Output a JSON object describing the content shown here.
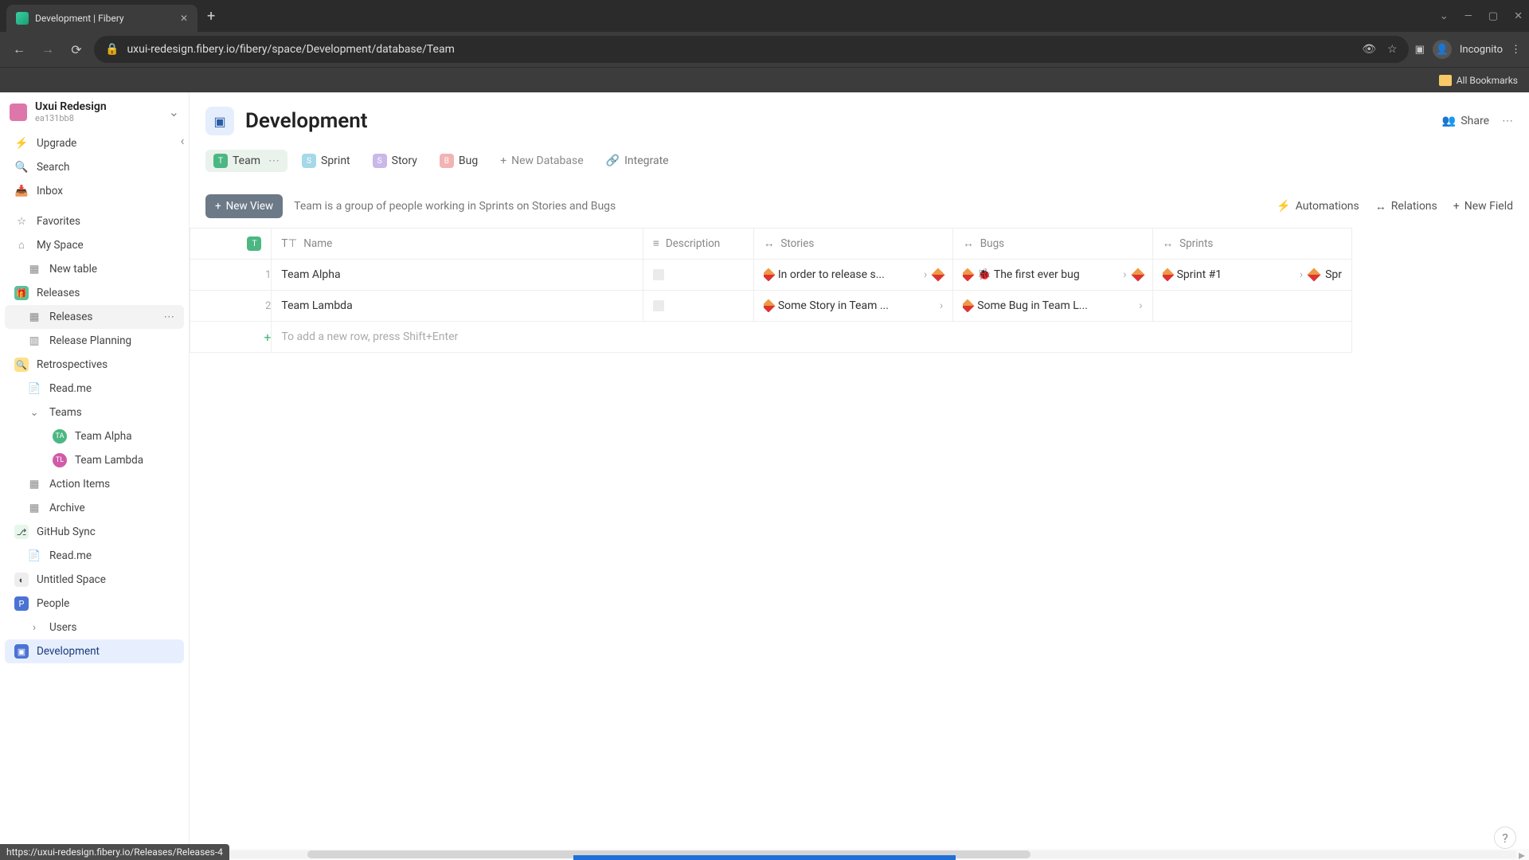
{
  "browser": {
    "tab_title": "Development | Fibery",
    "url": "uxui-redesign.fibery.io/fibery/space/Development/database/Team",
    "incognito_label": "Incognito",
    "bookmarks_label": "All Bookmarks"
  },
  "workspace": {
    "name": "Uxui Redesign",
    "sub": "ea131bb8"
  },
  "sidebar": {
    "upgrade": "Upgrade",
    "search": "Search",
    "inbox": "Inbox",
    "favorites": "Favorites",
    "myspace": "My Space",
    "newtable": "New table",
    "releases": "Releases",
    "releases_sub": "Releases",
    "release_planning": "Release Planning",
    "retro": "Retrospectives",
    "readme1": "Read.me",
    "teams": "Teams",
    "team_alpha": "Team Alpha",
    "team_lambda": "Team Lambda",
    "action_items": "Action Items",
    "archive": "Archive",
    "github": "GitHub Sync",
    "readme2": "Read.me",
    "untitled": "Untitled Space",
    "people": "People",
    "users": "Users",
    "development": "Development"
  },
  "page": {
    "title": "Development",
    "share": "Share"
  },
  "tabs": {
    "team": "Team",
    "sprint": "Sprint",
    "story": "Story",
    "bug": "Bug",
    "newdb": "New Database",
    "integrate": "Integrate"
  },
  "view": {
    "new_view": "New View",
    "desc": "Team is a group of people working in Sprints on Stories and Bugs",
    "automations": "Automations",
    "relations": "Relations",
    "newfield": "New Field"
  },
  "table": {
    "cols": {
      "name": "Name",
      "description": "Description",
      "stories": "Stories",
      "bugs": "Bugs",
      "sprints": "Sprints"
    },
    "rows": [
      {
        "num": "1",
        "name": "Team Alpha",
        "story": "In order to release s...",
        "bug": "🐞 The first ever bug",
        "sprint": "Sprint #1",
        "sprint2": "Spr"
      },
      {
        "num": "2",
        "name": "Team Lambda",
        "story": "Some Story in Team ...",
        "bug": "Some Bug in Team L..."
      }
    ],
    "add_placeholder": "To add a new row, press Shift+Enter"
  },
  "status_url": "https://uxui-redesign.fibery.io/Releases/Releases-4",
  "help": "?"
}
